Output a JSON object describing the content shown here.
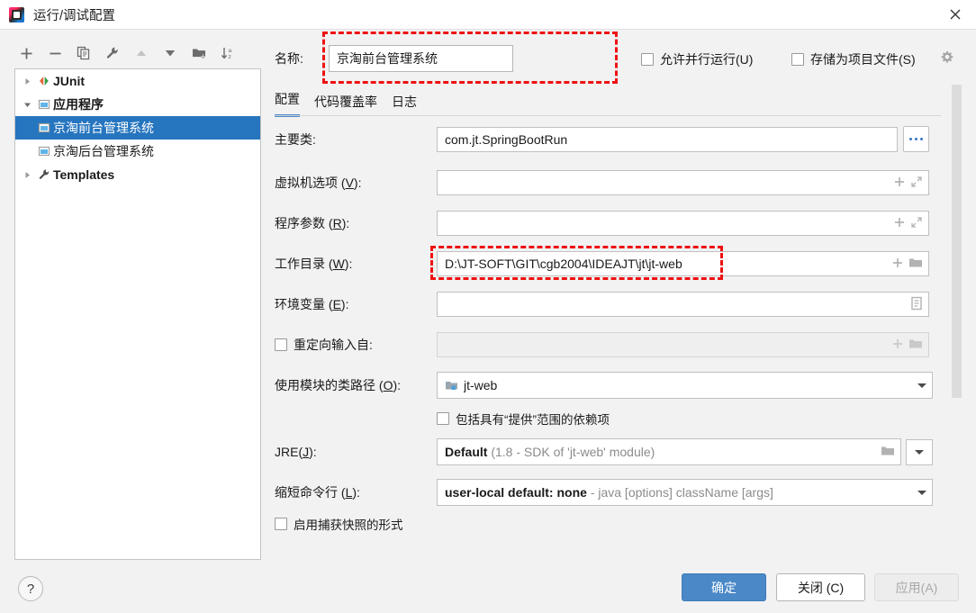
{
  "window": {
    "title": "运行/调试配置",
    "app_icon": "intellij-idea-icon",
    "close_icon": "close-icon"
  },
  "toolbar": {
    "buttons": [
      {
        "name": "add-configuration-button",
        "icon": "plus-icon"
      },
      {
        "name": "remove-configuration-button",
        "icon": "minus-icon"
      },
      {
        "name": "copy-configuration-button",
        "icon": "copy-icon"
      },
      {
        "name": "edit-templates-button",
        "icon": "wrench-icon"
      },
      {
        "name": "move-up-button",
        "icon": "arrow-up-icon"
      },
      {
        "name": "move-down-button",
        "icon": "arrow-down-icon"
      },
      {
        "name": "new-folder-button",
        "icon": "folder-add-icon"
      },
      {
        "name": "sort-configurations-button",
        "icon": "sort-az-icon"
      }
    ]
  },
  "tree": {
    "items": [
      {
        "label": "JUnit",
        "icon": "junit-icon",
        "twisty": "collapsed",
        "level": 0,
        "bold": true,
        "selected": false
      },
      {
        "label": "应用程序",
        "icon": "application-icon",
        "twisty": "expanded",
        "level": 0,
        "bold": true,
        "selected": false
      },
      {
        "label": "京淘前台管理系统",
        "icon": "application-icon",
        "twisty": "none",
        "level": 1,
        "bold": false,
        "selected": true
      },
      {
        "label": "京淘后台管理系统",
        "icon": "application-icon",
        "twisty": "none",
        "level": 1,
        "bold": false,
        "selected": false
      },
      {
        "label": "Templates",
        "icon": "wrench-icon",
        "twisty": "collapsed",
        "level": 0,
        "bold": true,
        "selected": false
      }
    ]
  },
  "header": {
    "name_label": "名称:",
    "name_value": "京淘前台管理系统",
    "allow_parallel_label": "允许并行运行(U)",
    "allow_parallel_checked": false,
    "store_as_project_file_label": "存储为项目文件(S)",
    "store_as_project_file_checked": false,
    "gear_icon": "gear-icon",
    "highlight_color": "#ee1111"
  },
  "tabs": [
    {
      "label": "配置",
      "active": true
    },
    {
      "label": "代码覆盖率",
      "active": false
    },
    {
      "label": "日志",
      "active": false
    }
  ],
  "form": {
    "main_class": {
      "label": "主要类:",
      "value": "com.jt.SpringBootRun",
      "browse_button": "..."
    },
    "vm_options": {
      "label_prefix": "虚拟机选项 (",
      "label_mnemonic": "V",
      "label_suffix": "):",
      "value": ""
    },
    "program_arguments": {
      "label_prefix": "程序参数 (",
      "label_mnemonic": "R",
      "label_suffix": "):",
      "value": ""
    },
    "working_directory": {
      "label_prefix": "工作目录 (",
      "label_mnemonic": "W",
      "label_suffix": "):",
      "value": "D:\\JT-SOFT\\GIT\\cgb2004\\IDEAJT\\jt\\jt-web",
      "highlighted": true
    },
    "environment_variables": {
      "label_prefix": "环境变量 (",
      "label_mnemonic": "E",
      "label_suffix": "):",
      "value": ""
    },
    "redirect_input": {
      "label": "重定向输入自:",
      "checked": false,
      "value": ""
    },
    "module_classpath": {
      "label_prefix": "使用模块的类路径 (",
      "label_mnemonic": "O",
      "label_suffix": "):",
      "value": "jt-web",
      "icon": "module-icon"
    },
    "include_provided_scope": {
      "label": "包括具有“提供”范围的依赖项",
      "checked": false
    },
    "jre": {
      "label_prefix": "JRE(",
      "label_mnemonic": "J",
      "label_suffix": "):",
      "value_strong": "Default",
      "value_gray": "(1.8 - SDK of 'jt-web' module)"
    },
    "shorten_command_line": {
      "label_prefix": "缩短命令行 (",
      "label_mnemonic": "L",
      "label_suffix": "):",
      "value_strong": "user-local default: none",
      "value_gray": "- java [options] className [args]"
    },
    "enable_capture_snapshot": {
      "label": "启用捕获快照的形式",
      "checked": false
    }
  },
  "footer": {
    "help_label": "?",
    "ok_label": "确定",
    "close_label": "关闭 (C)",
    "apply_label": "应用(A)",
    "apply_enabled": false,
    "primary_color": "#4a88c7"
  }
}
